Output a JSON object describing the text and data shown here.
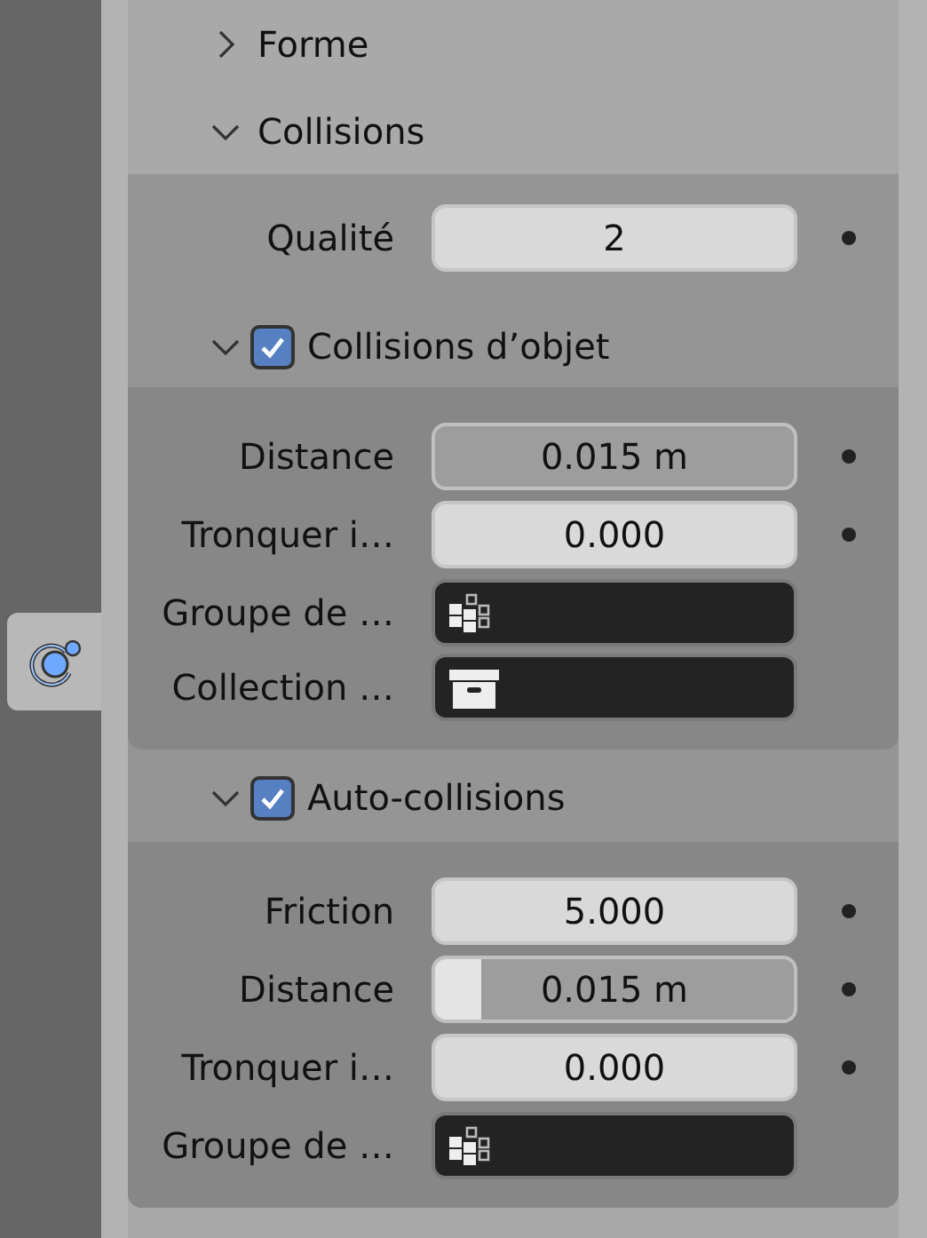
{
  "sidebar_tab": {
    "selected": true
  },
  "panels": [
    {
      "title": "Forme",
      "expanded": false
    },
    {
      "title": "Collisions",
      "expanded": true,
      "rows": [
        {
          "kind": "number",
          "label": "Qualité",
          "value": "2"
        }
      ],
      "subpanels": [
        {
          "title": "Collisions d’objet",
          "expanded": true,
          "checked": true,
          "rows": [
            {
              "kind": "slider",
              "label": "Distance",
              "value": "0.015 m",
              "level": 0
            },
            {
              "kind": "number",
              "label": "Tronquer i…",
              "value": "0.000"
            },
            {
              "kind": "group_picker",
              "label": "Groupe de …"
            },
            {
              "kind": "collection_picker",
              "label": "Collection …"
            }
          ]
        },
        {
          "title": "Auto-collisions",
          "expanded": true,
          "checked": true,
          "rows": [
            {
              "kind": "number",
              "label": "Friction",
              "value": "5.000"
            },
            {
              "kind": "slider",
              "label": "Distance",
              "value": "0.015 m",
              "level": 0.13
            },
            {
              "kind": "number",
              "label": "Tronquer i…",
              "value": "0.000"
            },
            {
              "kind": "group_picker",
              "label": "Groupe de …"
            }
          ]
        }
      ]
    }
  ]
}
